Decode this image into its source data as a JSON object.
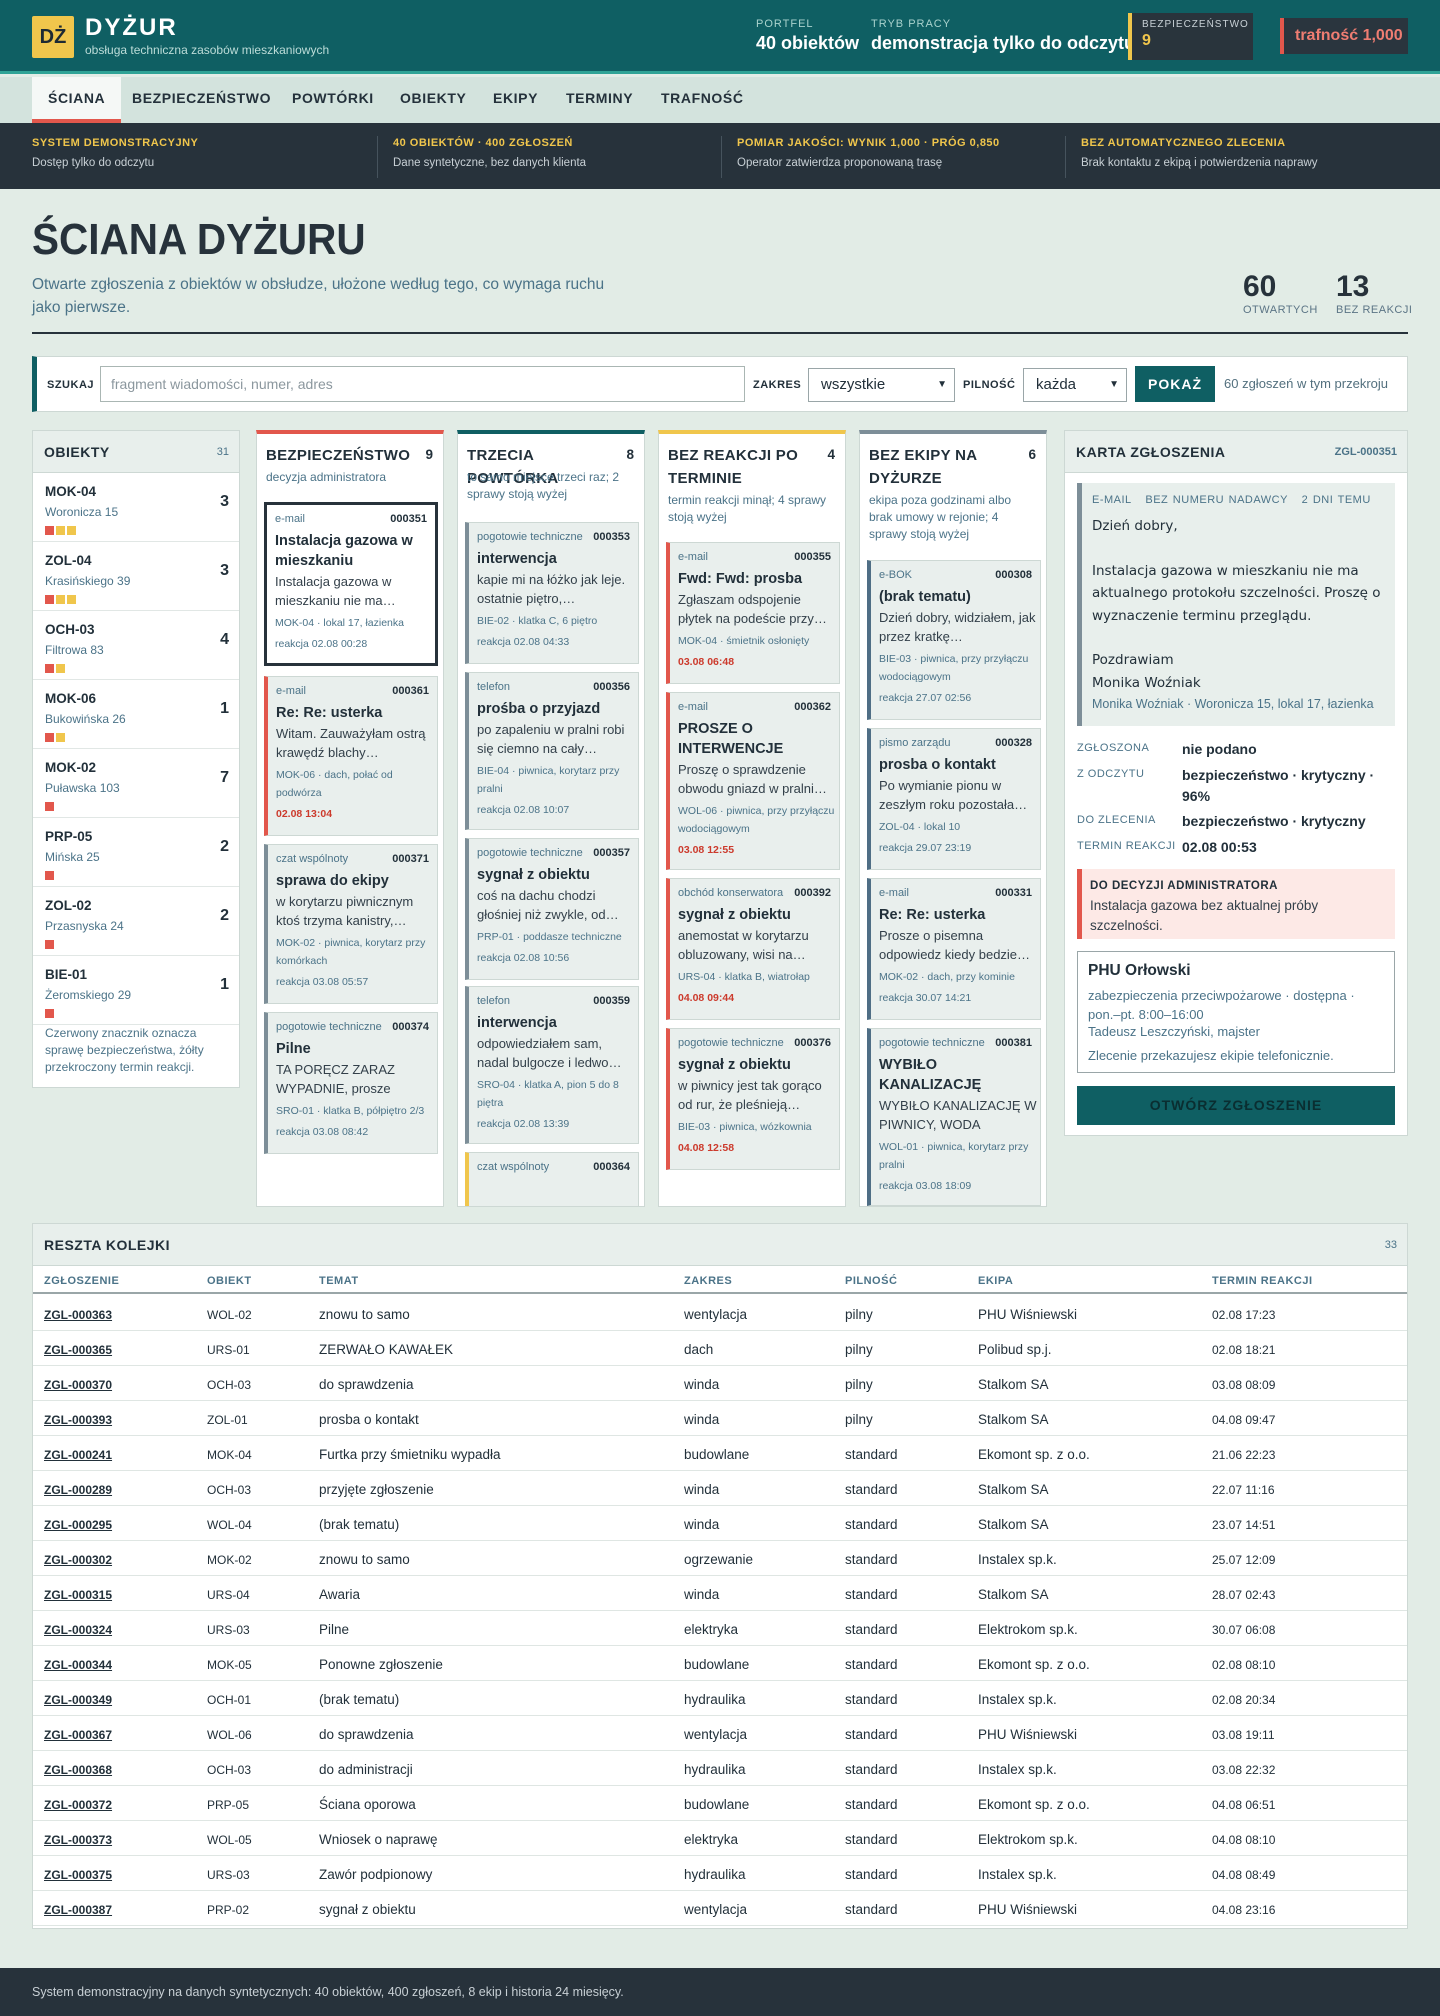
{
  "header": {
    "logo": "DŻ",
    "app_name": "DYŻUR",
    "app_subtitle": "obsługa techniczna zasobów mieszkaniowych",
    "portfolio_label": "PORTFEL",
    "portfolio_value": "40 obiektów",
    "mode_label": "TRYB PRACY",
    "mode_value": "demonstracja tylko do odczytu",
    "safety_label": "BEZPIECZEŃSTWO",
    "safety_value": "9",
    "accuracy": "trafność 1,000"
  },
  "nav": {
    "tabs": [
      "ŚCIANA",
      "BEZPIECZEŃSTWO",
      "POWTÓRKI",
      "OBIEKTY",
      "EKIPY",
      "TERMINY",
      "TRAFNOŚĆ"
    ],
    "active": "ŚCIANA"
  },
  "notices": [
    {
      "title": "SYSTEM DEMONSTRACYJNY",
      "desc": "Dostęp tylko do odczytu"
    },
    {
      "title": "40 OBIEKTÓW · 400 ZGŁOSZEŃ",
      "desc": "Dane syntetyczne, bez danych klienta"
    },
    {
      "title": "POMIAR JAKOŚCI: WYNIK 1,000 · PRÓG 0,850",
      "desc": "Operator zatwierdza proponowaną trasę"
    },
    {
      "title": "BEZ AUTOMATYCZNEGO ZLECENIA",
      "desc": "Brak kontaktu z ekipą i potwierdzenia naprawy"
    }
  ],
  "page": {
    "title": "ŚCIANA DYŻURU",
    "desc": "Otwarte zgłoszenia z obiektów w obsłudze, ułożone według tego, co wymaga ruchu jako pierwsze.",
    "open_count": "60",
    "open_label": "OTWARTYCH",
    "noreact_count": "13",
    "noreact_label": "BEZ REAKCJI"
  },
  "search": {
    "label": "SZUKAJ",
    "placeholder": "fragment wiadomości, numer, adres",
    "scope_label": "ZAKRES",
    "scope_value": "wszystkie",
    "urgency_label": "PILNOŚĆ",
    "urgency_value": "każda",
    "button": "POKAŻ",
    "result": "60 zgłoszeń w tym przekroju"
  },
  "objects": {
    "title": "OBIEKTY",
    "count": "31",
    "note": "Czerwony znacznik oznacza sprawę bezpieczeństwa, żółty przekroczony termin reakcji.",
    "colors": {
      "red": "#e2574c",
      "yellow": "#f0c64c"
    },
    "items": [
      {
        "code": "MOK-04",
        "addr": "Woronicza 15",
        "count": "3",
        "marks": [
          "red",
          "yellow",
          "yellow"
        ]
      },
      {
        "code": "ZOL-04",
        "addr": "Krasińskiego 39",
        "count": "3",
        "marks": [
          "red",
          "yellow",
          "yellow"
        ]
      },
      {
        "code": "OCH-03",
        "addr": "Filtrowa 83",
        "count": "4",
        "marks": [
          "red",
          "yellow"
        ]
      },
      {
        "code": "MOK-06",
        "addr": "Bukowińska 26",
        "count": "1",
        "marks": [
          "red",
          "yellow"
        ]
      },
      {
        "code": "MOK-02",
        "addr": "Puławska 103",
        "count": "7",
        "marks": [
          "red"
        ]
      },
      {
        "code": "PRP-05",
        "addr": "Mińska 25",
        "count": "2",
        "marks": [
          "red"
        ]
      },
      {
        "code": "ZOL-02",
        "addr": "Przasnyska 24",
        "count": "2",
        "marks": [
          "red"
        ]
      },
      {
        "code": "BIE-01",
        "addr": "Żeromskiego 29",
        "count": "1",
        "marks": [
          "red"
        ]
      }
    ]
  },
  "columns": [
    {
      "title": "BEZPIECZEŃSTWO",
      "count": "9",
      "sub": "decyzja administratora",
      "color": "#e2574c",
      "cards": [
        {
          "src": "e-mail",
          "num": "000351",
          "title": "Instalacja gazowa w mieszkaniu",
          "body": "Instalacja gazowa w mieszkaniu nie ma…",
          "loc": "MOK-04 · lokal 17, łazienka",
          "when": "reakcja 02.08 00:28",
          "late": false,
          "accent": "#27323b",
          "selected": true
        },
        {
          "src": "e-mail",
          "num": "000361",
          "title": "Re: Re: usterka",
          "body": "Witam. Zauważyłam ostrą krawędź blachy…",
          "loc": "MOK-06 · dach, połać od podwórza",
          "when": "02.08 13:04",
          "late": true,
          "accent": "#e2574c"
        },
        {
          "src": "czat wspólnoty",
          "num": "000371",
          "title": "sprawa do ekipy",
          "body": "w korytarzu piwnicznym ktoś trzyma kanistry,…",
          "loc": "MOK-02 · piwnica, korytarz przy komórkach",
          "when": "reakcja 03.08 05:57",
          "late": false,
          "accent": "#7d8e98"
        },
        {
          "src": "pogotowie techniczne",
          "num": "000374",
          "title": "Pilne",
          "body": "TA PORĘCZ ZARAZ WYPADNIE, prosze zeby…",
          "loc": "SRO-01 · klatka B, półpiętro 2/3",
          "when": "reakcja 03.08 08:42",
          "late": false,
          "accent": "#7d8e98"
        }
      ]
    },
    {
      "title": "TRZECIA POWTÓRKA",
      "count": "8",
      "sub": "to samo miejsce trzeci raz; 2 sprawy stoją wyżej",
      "color": "#0f5f63",
      "cards": [
        {
          "src": "pogotowie techniczne",
          "num": "000353",
          "title": "interwencja",
          "body": "kapie mi na łóżko jak leje. ostatnie piętro,…",
          "loc": "BIE-02 · klatka C, 6 piętro",
          "when": "reakcja 02.08 04:33",
          "late": false,
          "accent": "#7d8e98"
        },
        {
          "src": "telefon",
          "num": "000356",
          "title": "prośba o przyjazd",
          "body": "po zapaleniu w pralni robi się ciemno na cały…",
          "loc": "BIE-04 · piwnica, korytarz przy pralni",
          "when": "reakcja 02.08 10:07",
          "late": false,
          "accent": "#7d8e98"
        },
        {
          "src": "pogotowie techniczne",
          "num": "000357",
          "title": "sygnał z obiektu",
          "body": "coś na dachu chodzi głośniej niż zwykle, od…",
          "loc": "PRP-01 · poddasze techniczne",
          "when": "reakcja 02.08 10:56",
          "late": false,
          "accent": "#7d8e98"
        },
        {
          "src": "telefon",
          "num": "000359",
          "title": "interwencja",
          "body": "odpowiedziałem sam, nadal bulgocze i ledwo…",
          "loc": "SRO-04 · klatka A, pion 5 do 8 piętra",
          "when": "reakcja 02.08 13:39",
          "late": false,
          "accent": "#7d8e98"
        },
        {
          "src": "czat wspólnoty",
          "num": "000364",
          "title": "",
          "body": "",
          "loc": "",
          "when": "",
          "late": false,
          "accent": "#f0c64c"
        }
      ]
    },
    {
      "title": "BEZ REAKCJI PO TERMINIE",
      "count": "4",
      "sub": "termin reakcji minął; 4 sprawy stoją wyżej",
      "color": "#f0c64c",
      "cards": [
        {
          "src": "e-mail",
          "num": "000355",
          "title": "Fwd: Fwd: prosba",
          "body": "Zgłaszam odspojenie płytek na podeście przy…",
          "loc": "MOK-04 · śmietnik osłonięty",
          "when": "03.08 06:48",
          "late": true,
          "accent": "#e2574c"
        },
        {
          "src": "e-mail",
          "num": "000362",
          "title": "PROSZE O INTERWENCJE",
          "body": "Proszę o sprawdzenie obwodu gniazd w pralni…",
          "loc": "WOL-06 · piwnica, przy przyłączu wodociągowym",
          "when": "03.08 12:55",
          "late": true,
          "accent": "#e2574c"
        },
        {
          "src": "obchód konserwatora",
          "num": "000392",
          "title": "sygnał z obiektu",
          "body": "anemostat w korytarzu obluzowany, wisi na…",
          "loc": "URS-04 · klatka B, wiatrołap",
          "when": "04.08 09:44",
          "late": true,
          "accent": "#e2574c"
        },
        {
          "src": "pogotowie techniczne",
          "num": "000376",
          "title": "sygnał z obiektu",
          "body": "w piwnicy jest tak gorąco od rur, że pleśnieją…",
          "loc": "BIE-03 · piwnica, wózkownia",
          "when": "04.08 12:58",
          "late": true,
          "accent": "#e2574c"
        }
      ]
    },
    {
      "title": "BEZ EKIPY NA DYŻURZE",
      "count": "6",
      "sub": "ekipa poza godzinami albo brak umowy w rejonie; 4 sprawy stoją wyżej",
      "color": "#7d8e98",
      "cards": [
        {
          "src": "e-BOK",
          "num": "000308",
          "title": "(brak tematu)",
          "body": "Dzień dobry, widziałem, jak przez kratkę…",
          "loc": "BIE-03 · piwnica, przy przyłączu wodociągowym",
          "when": "reakcja 27.07 02:56",
          "late": false,
          "accent": "#4f6e85"
        },
        {
          "src": "pismo zarządu",
          "num": "000328",
          "title": "prosba o kontakt",
          "body": "Po wymianie pionu w zeszłym roku pozostała…",
          "loc": "ZOL-04 · lokal 10",
          "when": "reakcja 29.07 23:19",
          "late": false,
          "accent": "#4f6e85"
        },
        {
          "src": "e-mail",
          "num": "000331",
          "title": "Re: Re: usterka",
          "body": "Prosze o pisemna odpowiedz kiedy bedzie…",
          "loc": "MOK-02 · dach, przy kominie",
          "when": "reakcja 30.07 14:21",
          "late": false,
          "accent": "#4f6e85"
        },
        {
          "src": "pogotowie techniczne",
          "num": "000381",
          "title": "WYBIŁO KANALIZACJĘ",
          "body": "WYBIŁO KANALIZACJĘ W PIWNICY, WODA WCHOD…",
          "loc": "WOL-01 · piwnica, korytarz przy pralni",
          "when": "reakcja 03.08 18:09",
          "late": false,
          "accent": "#4f6e85"
        }
      ]
    }
  ],
  "detail": {
    "title": "KARTA ZGŁOSZENIA",
    "id": "ZGL-000351",
    "channel": "E-MAIL",
    "sender": "BEZ NUMERU NADAWCY",
    "age": "2 DNI TEMU",
    "message": [
      "Dzień dobry,",
      "",
      "Instalacja gazowa w mieszkaniu nie ma aktualnego protokołu szczelności. Proszę o wyznaczenie terminu przeglądu.",
      "",
      "Pozdrawiam",
      "Monika Woźniak"
    ],
    "signature": "Monika Woźniak · Woronicza 15, lokal 17, łazienka",
    "fields": [
      {
        "label": "ZGŁOSZONA",
        "value": "nie podano"
      },
      {
        "label": "Z ODCZYTU",
        "value": "bezpieczeństwo · krytyczny · 96%"
      },
      {
        "label": "DO ZLECENIA",
        "value": "bezpieczeństwo · krytyczny"
      },
      {
        "label": "TERMIN REAKCJI",
        "value": "02.08 00:53"
      }
    ],
    "alert_title": "DO DECYZJI ADMINISTRATORA",
    "alert_text": "Instalacja gazowa bez aktualnej próby szczelności.",
    "crew_name": "PHU Orłowski",
    "crew_desc": "zabezpieczenia przeciwpożarowe · dostępna · pon.–pt. 8:00–16:00",
    "crew_contact": "Tadeusz Leszczyński, majster",
    "crew_note": "Zlecenie przekazujesz ekipie telefonicznie.",
    "open_button": "OTWÓRZ ZGŁOSZENIE"
  },
  "queue": {
    "title": "RESZTA KOLEJKI",
    "count": "33",
    "columns": [
      "ZGŁOSZENIE",
      "OBIEKT",
      "TEMAT",
      "ZAKRES",
      "PILNOŚĆ",
      "EKIPA",
      "TERMIN REAKCJI"
    ],
    "rows": [
      [
        "ZGL-000363",
        "WOL-02",
        "znowu to samo",
        "wentylacja",
        "pilny",
        "PHU Wiśniewski",
        "02.08 17:23"
      ],
      [
        "ZGL-000365",
        "URS-01",
        "ZERWAŁO KAWAŁEK",
        "dach",
        "pilny",
        "Polibud sp.j.",
        "02.08 18:21"
      ],
      [
        "ZGL-000370",
        "OCH-03",
        "do sprawdzenia",
        "winda",
        "pilny",
        "Stalkom SA",
        "03.08 08:09"
      ],
      [
        "ZGL-000393",
        "ZOL-01",
        "prosba o kontakt",
        "winda",
        "pilny",
        "Stalkom SA",
        "04.08 09:47"
      ],
      [
        "ZGL-000241",
        "MOK-04",
        "Furtka przy śmietniku wypadła",
        "budowlane",
        "standard",
        "Ekomont sp. z o.o.",
        "21.06 22:23"
      ],
      [
        "ZGL-000289",
        "OCH-03",
        "przyjęte zgłoszenie",
        "winda",
        "standard",
        "Stalkom SA",
        "22.07 11:16"
      ],
      [
        "ZGL-000295",
        "WOL-04",
        "(brak tematu)",
        "winda",
        "standard",
        "Stalkom SA",
        "23.07 14:51"
      ],
      [
        "ZGL-000302",
        "MOK-02",
        "znowu to samo",
        "ogrzewanie",
        "standard",
        "Instalex sp.k.",
        "25.07 12:09"
      ],
      [
        "ZGL-000315",
        "URS-04",
        "Awaria",
        "winda",
        "standard",
        "Stalkom SA",
        "28.07 02:43"
      ],
      [
        "ZGL-000324",
        "URS-03",
        "Pilne",
        "elektryka",
        "standard",
        "Elektrokom sp.k.",
        "30.07 06:08"
      ],
      [
        "ZGL-000344",
        "MOK-05",
        "Ponowne zgłoszenie",
        "budowlane",
        "standard",
        "Ekomont sp. z o.o.",
        "02.08 08:10"
      ],
      [
        "ZGL-000349",
        "OCH-01",
        "(brak tematu)",
        "hydraulika",
        "standard",
        "Instalex sp.k.",
        "02.08 20:34"
      ],
      [
        "ZGL-000367",
        "WOL-06",
        "do sprawdzenia",
        "wentylacja",
        "standard",
        "PHU Wiśniewski",
        "03.08 19:11"
      ],
      [
        "ZGL-000368",
        "OCH-03",
        "do administracji",
        "hydraulika",
        "standard",
        "Instalex sp.k.",
        "03.08 22:32"
      ],
      [
        "ZGL-000372",
        "PRP-05",
        "Ściana oporowa",
        "budowlane",
        "standard",
        "Ekomont sp. z o.o.",
        "04.08 06:51"
      ],
      [
        "ZGL-000373",
        "WOL-05",
        "Wniosek o naprawę",
        "elektryka",
        "standard",
        "Elektrokom sp.k.",
        "04.08 08:10"
      ],
      [
        "ZGL-000375",
        "URS-03",
        "Zawór podpionowy",
        "hydraulika",
        "standard",
        "Instalex sp.k.",
        "04.08 08:49"
      ],
      [
        "ZGL-000387",
        "PRP-02",
        "sygnał z obiektu",
        "wentylacja",
        "standard",
        "PHU Wiśniewski",
        "04.08 23:16"
      ]
    ]
  },
  "footer": "System demonstracyjny na danych syntetycznych: 40 obiektów, 400 zgłoszeń, 8 ekip i historia 24 miesięcy."
}
